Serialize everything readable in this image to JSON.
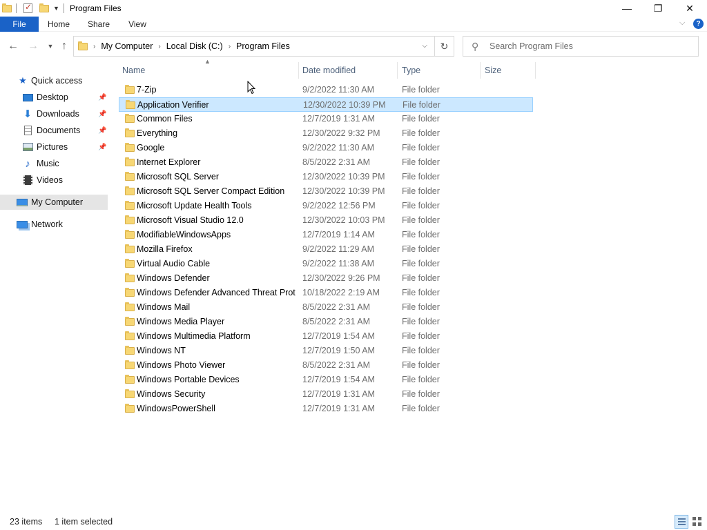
{
  "window": {
    "title": "Program Files",
    "min_glyph": "—",
    "max_glyph": "❐",
    "close_glyph": "✕"
  },
  "ribbon": {
    "tabs": [
      {
        "label": "File"
      },
      {
        "label": "Home"
      },
      {
        "label": "Share"
      },
      {
        "label": "View"
      }
    ],
    "help": "?"
  },
  "address": {
    "crumbs": [
      "My Computer",
      "Local Disk (C:)",
      "Program Files"
    ]
  },
  "search": {
    "placeholder": "Search Program Files"
  },
  "sidebar": {
    "items": [
      {
        "label": "Quick access",
        "icon": "star-icon"
      },
      {
        "label": "Desktop",
        "icon": "desktop-icon",
        "pinned": true
      },
      {
        "label": "Downloads",
        "icon": "download-icon",
        "pinned": true
      },
      {
        "label": "Documents",
        "icon": "documents-icon",
        "pinned": true
      },
      {
        "label": "Pictures",
        "icon": "pictures-icon",
        "pinned": true
      },
      {
        "label": "Music",
        "icon": "music-icon"
      },
      {
        "label": "Videos",
        "icon": "videos-icon"
      },
      {
        "label": "My Computer",
        "icon": "computer-icon",
        "selected": true
      },
      {
        "label": "Network",
        "icon": "network-icon"
      }
    ]
  },
  "columns": {
    "name": "Name",
    "date": "Date modified",
    "type": "Type",
    "size": "Size"
  },
  "files": [
    {
      "name": "7-Zip",
      "date": "9/2/2022 11:30 AM",
      "type": "File folder",
      "size": ""
    },
    {
      "name": "Application Verifier",
      "date": "12/30/2022 10:39 PM",
      "type": "File folder",
      "size": "",
      "selected": true
    },
    {
      "name": "Common Files",
      "date": "12/7/2019 1:31 AM",
      "type": "File folder",
      "size": ""
    },
    {
      "name": "Everything",
      "date": "12/30/2022 9:32 PM",
      "type": "File folder",
      "size": ""
    },
    {
      "name": "Google",
      "date": "9/2/2022 11:30 AM",
      "type": "File folder",
      "size": ""
    },
    {
      "name": "Internet Explorer",
      "date": "8/5/2022 2:31 AM",
      "type": "File folder",
      "size": ""
    },
    {
      "name": "Microsoft SQL Server",
      "date": "12/30/2022 10:39 PM",
      "type": "File folder",
      "size": ""
    },
    {
      "name": "Microsoft SQL Server Compact Edition",
      "date": "12/30/2022 10:39 PM",
      "type": "File folder",
      "size": ""
    },
    {
      "name": "Microsoft Update Health Tools",
      "date": "9/2/2022 12:56 PM",
      "type": "File folder",
      "size": ""
    },
    {
      "name": "Microsoft Visual Studio 12.0",
      "date": "12/30/2022 10:03 PM",
      "type": "File folder",
      "size": ""
    },
    {
      "name": "ModifiableWindowsApps",
      "date": "12/7/2019 1:14 AM",
      "type": "File folder",
      "size": ""
    },
    {
      "name": "Mozilla Firefox",
      "date": "9/2/2022 11:29 AM",
      "type": "File folder",
      "size": ""
    },
    {
      "name": "Virtual Audio Cable",
      "date": "9/2/2022 11:38 AM",
      "type": "File folder",
      "size": ""
    },
    {
      "name": "Windows Defender",
      "date": "12/30/2022 9:26 PM",
      "type": "File folder",
      "size": ""
    },
    {
      "name": "Windows Defender Advanced Threat Prot...",
      "date": "10/18/2022 2:19 AM",
      "type": "File folder",
      "size": ""
    },
    {
      "name": "Windows Mail",
      "date": "8/5/2022 2:31 AM",
      "type": "File folder",
      "size": ""
    },
    {
      "name": "Windows Media Player",
      "date": "8/5/2022 2:31 AM",
      "type": "File folder",
      "size": ""
    },
    {
      "name": "Windows Multimedia Platform",
      "date": "12/7/2019 1:54 AM",
      "type": "File folder",
      "size": ""
    },
    {
      "name": "Windows NT",
      "date": "12/7/2019 1:50 AM",
      "type": "File folder",
      "size": ""
    },
    {
      "name": "Windows Photo Viewer",
      "date": "8/5/2022 2:31 AM",
      "type": "File folder",
      "size": ""
    },
    {
      "name": "Windows Portable Devices",
      "date": "12/7/2019 1:54 AM",
      "type": "File folder",
      "size": ""
    },
    {
      "name": "Windows Security",
      "date": "12/7/2019 1:31 AM",
      "type": "File folder",
      "size": ""
    },
    {
      "name": "WindowsPowerShell",
      "date": "12/7/2019 1:31 AM",
      "type": "File folder",
      "size": ""
    }
  ],
  "status": {
    "count": "23 items",
    "selection": "1 item selected"
  },
  "colors": {
    "accent": "#1a62c7",
    "selection_bg": "#cce8ff",
    "selection_border": "#99d1ff",
    "folder": "#f7d774"
  }
}
